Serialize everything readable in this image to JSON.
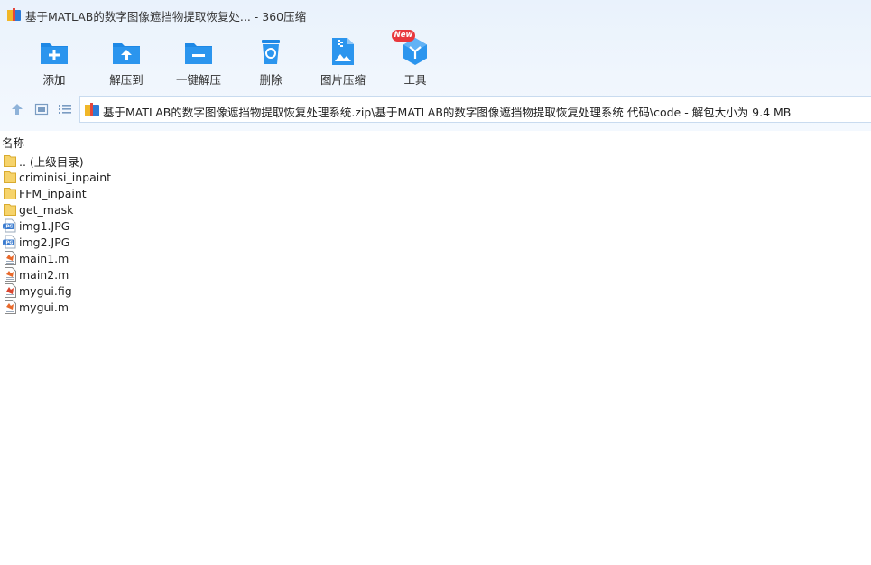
{
  "window": {
    "title": "基于MATLAB的数字图像遮挡物提取恢复处... - 360压缩"
  },
  "toolbar": {
    "items": [
      {
        "label": "添加",
        "icon": "add-icon"
      },
      {
        "label": "解压到",
        "icon": "extract-to-icon"
      },
      {
        "label": "一键解压",
        "icon": "one-click-extract-icon"
      },
      {
        "label": "删除",
        "icon": "delete-icon"
      },
      {
        "label": "图片压缩",
        "icon": "image-compress-icon"
      },
      {
        "label": "工具",
        "icon": "tools-icon"
      }
    ],
    "new_badge": "New"
  },
  "navbar": {
    "path": "基于MATLAB的数字图像遮挡物提取恢复处理系统.zip\\基于MATLAB的数字图像遮挡物提取恢复处理系统 代码\\code - 解包大小为 9.4 MB"
  },
  "filelist": {
    "column_name": "名称",
    "files": [
      {
        "name": ".. (上级目录)",
        "type": "folder"
      },
      {
        "name": "criminisi_inpaint",
        "type": "folder"
      },
      {
        "name": "FFM_inpaint",
        "type": "folder"
      },
      {
        "name": "get_mask",
        "type": "folder"
      },
      {
        "name": "img1.JPG",
        "type": "jpg"
      },
      {
        "name": "img2.JPG",
        "type": "jpg"
      },
      {
        "name": "main1.m",
        "type": "m"
      },
      {
        "name": "main2.m",
        "type": "m"
      },
      {
        "name": "mygui.fig",
        "type": "fig"
      },
      {
        "name": "mygui.m",
        "type": "m"
      }
    ]
  },
  "colors": {
    "accent_blue": "#1e88e5",
    "new_badge": "#e8383d",
    "folder_yellow": "#f6d36b"
  }
}
